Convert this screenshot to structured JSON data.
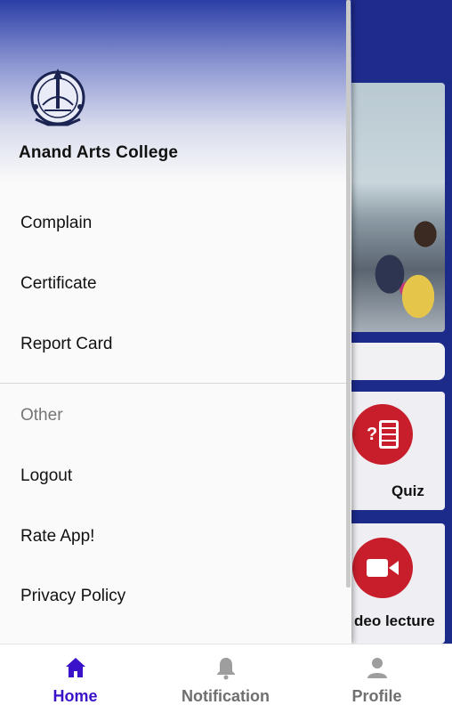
{
  "drawer": {
    "college_name": "Anand Arts College",
    "items": [
      {
        "label": "Complain"
      },
      {
        "label": "Certificate"
      },
      {
        "label": "Report Card"
      }
    ],
    "other_section": {
      "title": "Other",
      "items": [
        {
          "label": "Logout"
        },
        {
          "label": "Rate App!"
        },
        {
          "label": "Privacy Policy"
        }
      ]
    }
  },
  "background": {
    "cards": [
      {
        "label": "Quiz",
        "icon": "quiz-icon"
      },
      {
        "label": "deo lecture",
        "icon": "video-camera-icon"
      }
    ]
  },
  "bottom_nav": {
    "items": [
      {
        "label": "Home",
        "icon": "home-icon",
        "active": true
      },
      {
        "label": "Notification",
        "icon": "bell-icon",
        "active": false
      },
      {
        "label": "Profile",
        "icon": "person-icon",
        "active": false
      }
    ]
  },
  "colors": {
    "primary": "#1f2c8e",
    "active_nav": "#3a12c9",
    "inactive_nav": "#6f6f6f",
    "accent_red": "#c81e2c"
  }
}
